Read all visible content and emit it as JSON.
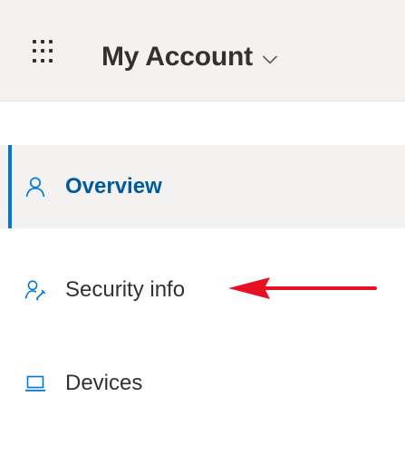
{
  "header": {
    "app_title": "My Account",
    "launcher_icon": "waffle-icon",
    "dropdown_icon": "chevron-down-icon"
  },
  "nav": {
    "items": [
      {
        "label": "Overview",
        "icon": "person-icon",
        "selected": true
      },
      {
        "label": "Security info",
        "icon": "person-key-icon",
        "selected": false
      },
      {
        "label": "Devices",
        "icon": "laptop-icon",
        "selected": false
      }
    ]
  },
  "annotation": {
    "arrow_color": "#e81123",
    "points_to": "Security info"
  },
  "colors": {
    "accent": "#0078d4",
    "selected_text": "#005a9e",
    "header_bg": "#f3f2f1",
    "text": "#323130"
  }
}
